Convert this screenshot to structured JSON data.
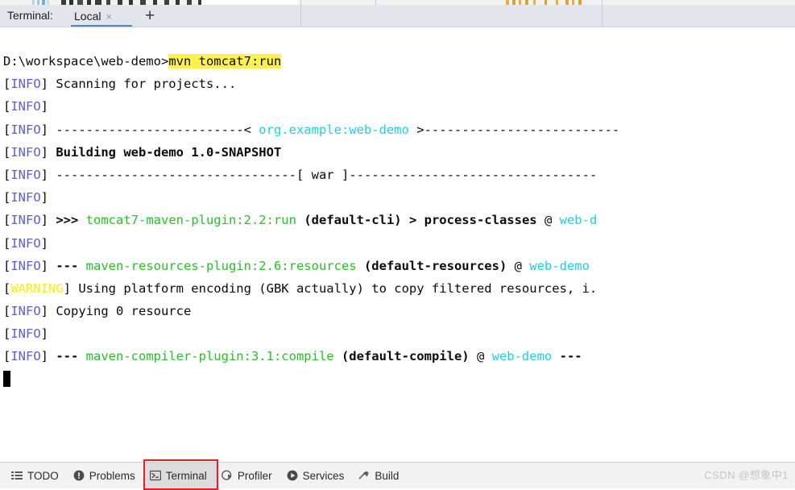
{
  "window": {
    "terminal_label": "Terminal:"
  },
  "tabs": {
    "items": [
      {
        "name": "Local",
        "close_glyph": "×"
      }
    ],
    "add_glyph": "+"
  },
  "console": {
    "prompt_path": "D:\\workspace\\web-demo>",
    "command": "mvn tomcat7:run",
    "lines": [
      {
        "id": "line-prompt",
        "segments": [
          {
            "text": "D:\\workspace\\web-demo>",
            "style": "plain"
          },
          {
            "text": "mvn tomcat7:run",
            "style": "highlight"
          }
        ]
      },
      {
        "id": "line-scanning",
        "segments": [
          {
            "text": "[",
            "style": "plain"
          },
          {
            "text": "INFO",
            "style": "info"
          },
          {
            "text": "] Scanning for projects...",
            "style": "plain"
          }
        ]
      },
      {
        "id": "line-info-blank-1",
        "segments": [
          {
            "text": "[",
            "style": "plain"
          },
          {
            "text": "INFO",
            "style": "info"
          },
          {
            "text": "] ",
            "style": "plain"
          }
        ]
      },
      {
        "id": "line-coords-banner",
        "segments": [
          {
            "text": "[",
            "style": "plain"
          },
          {
            "text": "INFO",
            "style": "info"
          },
          {
            "text": "] -------------------------< ",
            "style": "plain"
          },
          {
            "text": "org.example:web-demo",
            "style": "cyan"
          },
          {
            "text": " >--------------------------",
            "style": "plain"
          }
        ]
      },
      {
        "id": "line-building",
        "segments": [
          {
            "text": "[",
            "style": "plain"
          },
          {
            "text": "INFO",
            "style": "info"
          },
          {
            "text": "] ",
            "style": "plain"
          },
          {
            "text": "Building web-demo 1.0-SNAPSHOT",
            "style": "bold"
          }
        ]
      },
      {
        "id": "line-packaging-banner",
        "segments": [
          {
            "text": "[",
            "style": "plain"
          },
          {
            "text": "INFO",
            "style": "info"
          },
          {
            "text": "] --------------------------------[ war ]---------------------------------",
            "style": "plain"
          }
        ]
      },
      {
        "id": "line-info-blank-2",
        "segments": [
          {
            "text": "[",
            "style": "plain"
          },
          {
            "text": "INFO",
            "style": "info"
          },
          {
            "text": "] ",
            "style": "plain"
          }
        ]
      },
      {
        "id": "line-tomcat7-run",
        "segments": [
          {
            "text": "[",
            "style": "plain"
          },
          {
            "text": "INFO",
            "style": "info"
          },
          {
            "text": "] ",
            "style": "plain"
          },
          {
            "text": ">>> ",
            "style": "bold"
          },
          {
            "text": "tomcat7-maven-plugin:2.2:run",
            "style": "green"
          },
          {
            "text": " ",
            "style": "plain"
          },
          {
            "text": "(default-cli)",
            "style": "bold"
          },
          {
            "text": " ",
            "style": "plain"
          },
          {
            "text": "> process-classes",
            "style": "bold"
          },
          {
            "text": " @ ",
            "style": "plain"
          },
          {
            "text": "web-d",
            "style": "cyan"
          }
        ]
      },
      {
        "id": "line-info-blank-3",
        "segments": [
          {
            "text": "[",
            "style": "plain"
          },
          {
            "text": "INFO",
            "style": "info"
          },
          {
            "text": "] ",
            "style": "plain"
          }
        ]
      },
      {
        "id": "line-resources-plugin",
        "segments": [
          {
            "text": "[",
            "style": "plain"
          },
          {
            "text": "INFO",
            "style": "info"
          },
          {
            "text": "] ",
            "style": "plain"
          },
          {
            "text": "--- ",
            "style": "bold"
          },
          {
            "text": "maven-resources-plugin:2.6:resources",
            "style": "green"
          },
          {
            "text": " ",
            "style": "plain"
          },
          {
            "text": "(default-resources)",
            "style": "bold"
          },
          {
            "text": " @ ",
            "style": "plain"
          },
          {
            "text": "web-demo",
            "style": "cyan"
          }
        ]
      },
      {
        "id": "line-warning-encoding",
        "segments": [
          {
            "text": "[",
            "style": "plain"
          },
          {
            "text": "WARNING",
            "style": "warn"
          },
          {
            "text": "] Using platform encoding (GBK actually) to copy filtered resources, i.",
            "style": "plain"
          }
        ]
      },
      {
        "id": "line-copying",
        "segments": [
          {
            "text": "[",
            "style": "plain"
          },
          {
            "text": "INFO",
            "style": "info"
          },
          {
            "text": "] Copying 0 resource",
            "style": "plain"
          }
        ]
      },
      {
        "id": "line-info-blank-4",
        "segments": [
          {
            "text": "[",
            "style": "plain"
          },
          {
            "text": "INFO",
            "style": "info"
          },
          {
            "text": "] ",
            "style": "plain"
          }
        ]
      },
      {
        "id": "line-compiler-plugin",
        "segments": [
          {
            "text": "[",
            "style": "plain"
          },
          {
            "text": "INFO",
            "style": "info"
          },
          {
            "text": "] ",
            "style": "plain"
          },
          {
            "text": "--- ",
            "style": "bold"
          },
          {
            "text": "maven-compiler-plugin:3.1:compile",
            "style": "green"
          },
          {
            "text": " ",
            "style": "plain"
          },
          {
            "text": "(default-compile)",
            "style": "bold"
          },
          {
            "text": " @ ",
            "style": "plain"
          },
          {
            "text": "web-demo",
            "style": "cyan"
          },
          {
            "text": " ",
            "style": "plain"
          },
          {
            "text": "---",
            "style": "bold"
          }
        ]
      },
      {
        "id": "line-cursor",
        "segments": [
          {
            "text": "",
            "style": "cursor"
          }
        ]
      }
    ]
  },
  "statusbar": {
    "items": [
      {
        "label": "TODO",
        "icon": "list-icon",
        "active": false
      },
      {
        "label": "Problems",
        "icon": "warning-icon",
        "active": false
      },
      {
        "label": "Terminal",
        "icon": "terminal-icon",
        "active": true
      },
      {
        "label": "Profiler",
        "icon": "profiler-icon",
        "active": false
      },
      {
        "label": "Services",
        "icon": "play-icon",
        "active": false
      },
      {
        "label": "Build",
        "icon": "hammer-icon",
        "active": false
      }
    ],
    "watermark": "CSDN @想象中1"
  },
  "colors": {
    "info": "#5c5cda",
    "warning": "#f5f10e",
    "plugin_green": "#22c322",
    "artifact_cyan": "#1ad2e2",
    "command_highlight": "#fdf14a",
    "accent_tab_underline": "#4a88c7",
    "annotation_red": "#ee1c1c"
  }
}
